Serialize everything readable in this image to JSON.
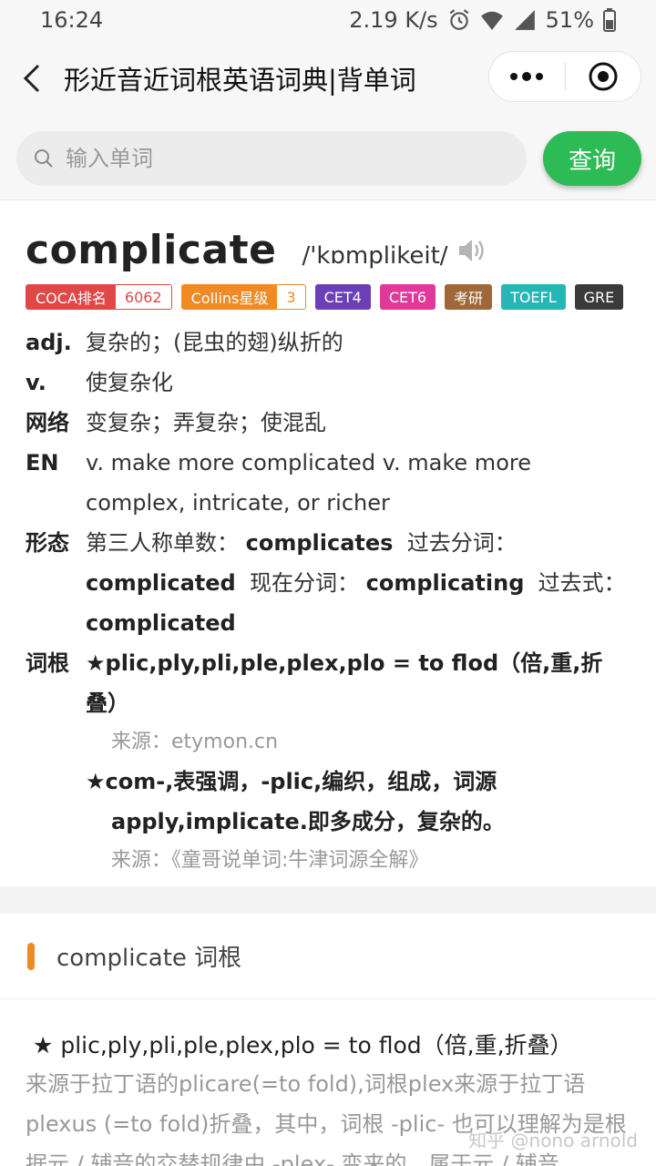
{
  "status_bar": {
    "time": "16:24",
    "speed": "2.19 K/s",
    "battery": "51%"
  },
  "nav": {
    "title": "形近音近词根英语词典|背单词"
  },
  "search": {
    "placeholder": "输入单词",
    "button": "查询"
  },
  "word": {
    "headword": "complicate",
    "phonetic": "/'kɒmplikeit/",
    "tags": {
      "coca_label": "COCA排名",
      "coca_value": "6062",
      "collins_label": "Collins星级",
      "collins_value": "3",
      "cet4": "CET4",
      "cet6": "CET6",
      "kaoyan": "考研",
      "toefl": "TOEFL",
      "gre": "GRE"
    },
    "colors": {
      "coca": "#e04848",
      "collins": "#f08a24",
      "cet4": "#6b3fb8",
      "cet6": "#e0399a",
      "kaoyan": "#a0683a",
      "toefl": "#27b6b6",
      "gre": "#3a3a3a"
    },
    "defs": {
      "adj_label": "adj.",
      "adj_text": "复杂的；(昆虫的翅)纵折的",
      "v_label": "v.",
      "v_text": "使复杂化",
      "net_label": "网络",
      "net_text": "变复杂；弄复杂；使混乱",
      "en_label": "EN",
      "en_text": "v. make more complicated v. make more complex, intricate, or richer"
    },
    "forms": {
      "label": "形态",
      "third_label": "第三人称单数：",
      "third_value": "complicates",
      "past_part_label": "过去分词：",
      "past_part_value": "complicated",
      "pres_part_label": "现在分词：",
      "pres_part_value": "complicating",
      "past_label": "过去式：",
      "past_value": "complicated"
    },
    "roots": {
      "label": "词根",
      "root1": "★plic,ply,pli,ple,plex,plo = to flod（倍,重,折叠）",
      "source1": "来源：etymon.cn",
      "root2": "★com-,表强调，-plic,编织，组成，词源apply,implicate.即多成分，复杂的。",
      "source2": "来源：《童哥说单词:牛津词源全解》"
    }
  },
  "section": {
    "title": "complicate 词根",
    "root": "★ plic,ply,pli,ple,plex,plo = to flod（倍,重,折叠）",
    "text": "来源于拉丁语的plicare(=to fold),词根plex来源于拉丁语plexus (=to fold)折叠，其中，词根 -plic- 也可以理解为是根据元 / 辅音的交替规律由 -plex- 变来的，属于元 / 辅音"
  },
  "watermark": "知乎 @nono arnold"
}
